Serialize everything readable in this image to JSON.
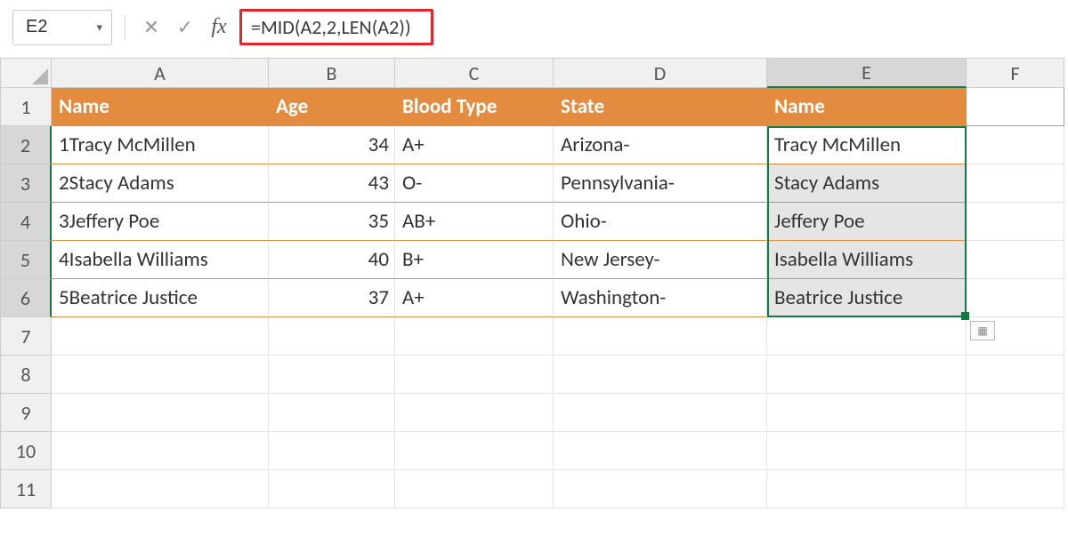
{
  "namebox": {
    "value": "E2"
  },
  "formula_bar": {
    "cancel_glyph": "✕",
    "confirm_glyph": "✓",
    "fx_label": "fx",
    "formula": "=MID(A2,2,LEN(A2))"
  },
  "columns": [
    "A",
    "B",
    "C",
    "D",
    "E",
    "F"
  ],
  "selected_column": "E",
  "rows": [
    "1",
    "2",
    "3",
    "4",
    "5",
    "6",
    "7",
    "8",
    "9",
    "10",
    "11"
  ],
  "selected_rows": [
    "2",
    "3",
    "4",
    "5",
    "6"
  ],
  "table": {
    "headers": {
      "A": "Name",
      "B": "Age",
      "C": "Blood Type",
      "D": "State",
      "E": "Name"
    },
    "data": [
      {
        "A": "1Tracy McMillen",
        "B": "34",
        "C": "A+",
        "D": "Arizona-",
        "E": "Tracy McMillen"
      },
      {
        "A": "2Stacy Adams",
        "B": "43",
        "C": "O-",
        "D": "Pennsylvania-",
        "E": "Stacy Adams"
      },
      {
        "A": "3Jeffery Poe",
        "B": "35",
        "C": "AB+",
        "D": "Ohio-",
        "E": "Jeffery Poe"
      },
      {
        "A": "4Isabella Williams",
        "B": "40",
        "C": "B+",
        "D": "New Jersey-",
        "E": "Isabella Williams"
      },
      {
        "A": "5Beatrice Justice",
        "B": "37",
        "C": "A+",
        "D": "Washington-",
        "E": "Beatrice Justice"
      }
    ]
  },
  "colors": {
    "accent": "#e38b3f",
    "selection": "#107c41",
    "highlight_border": "#e4242a"
  }
}
